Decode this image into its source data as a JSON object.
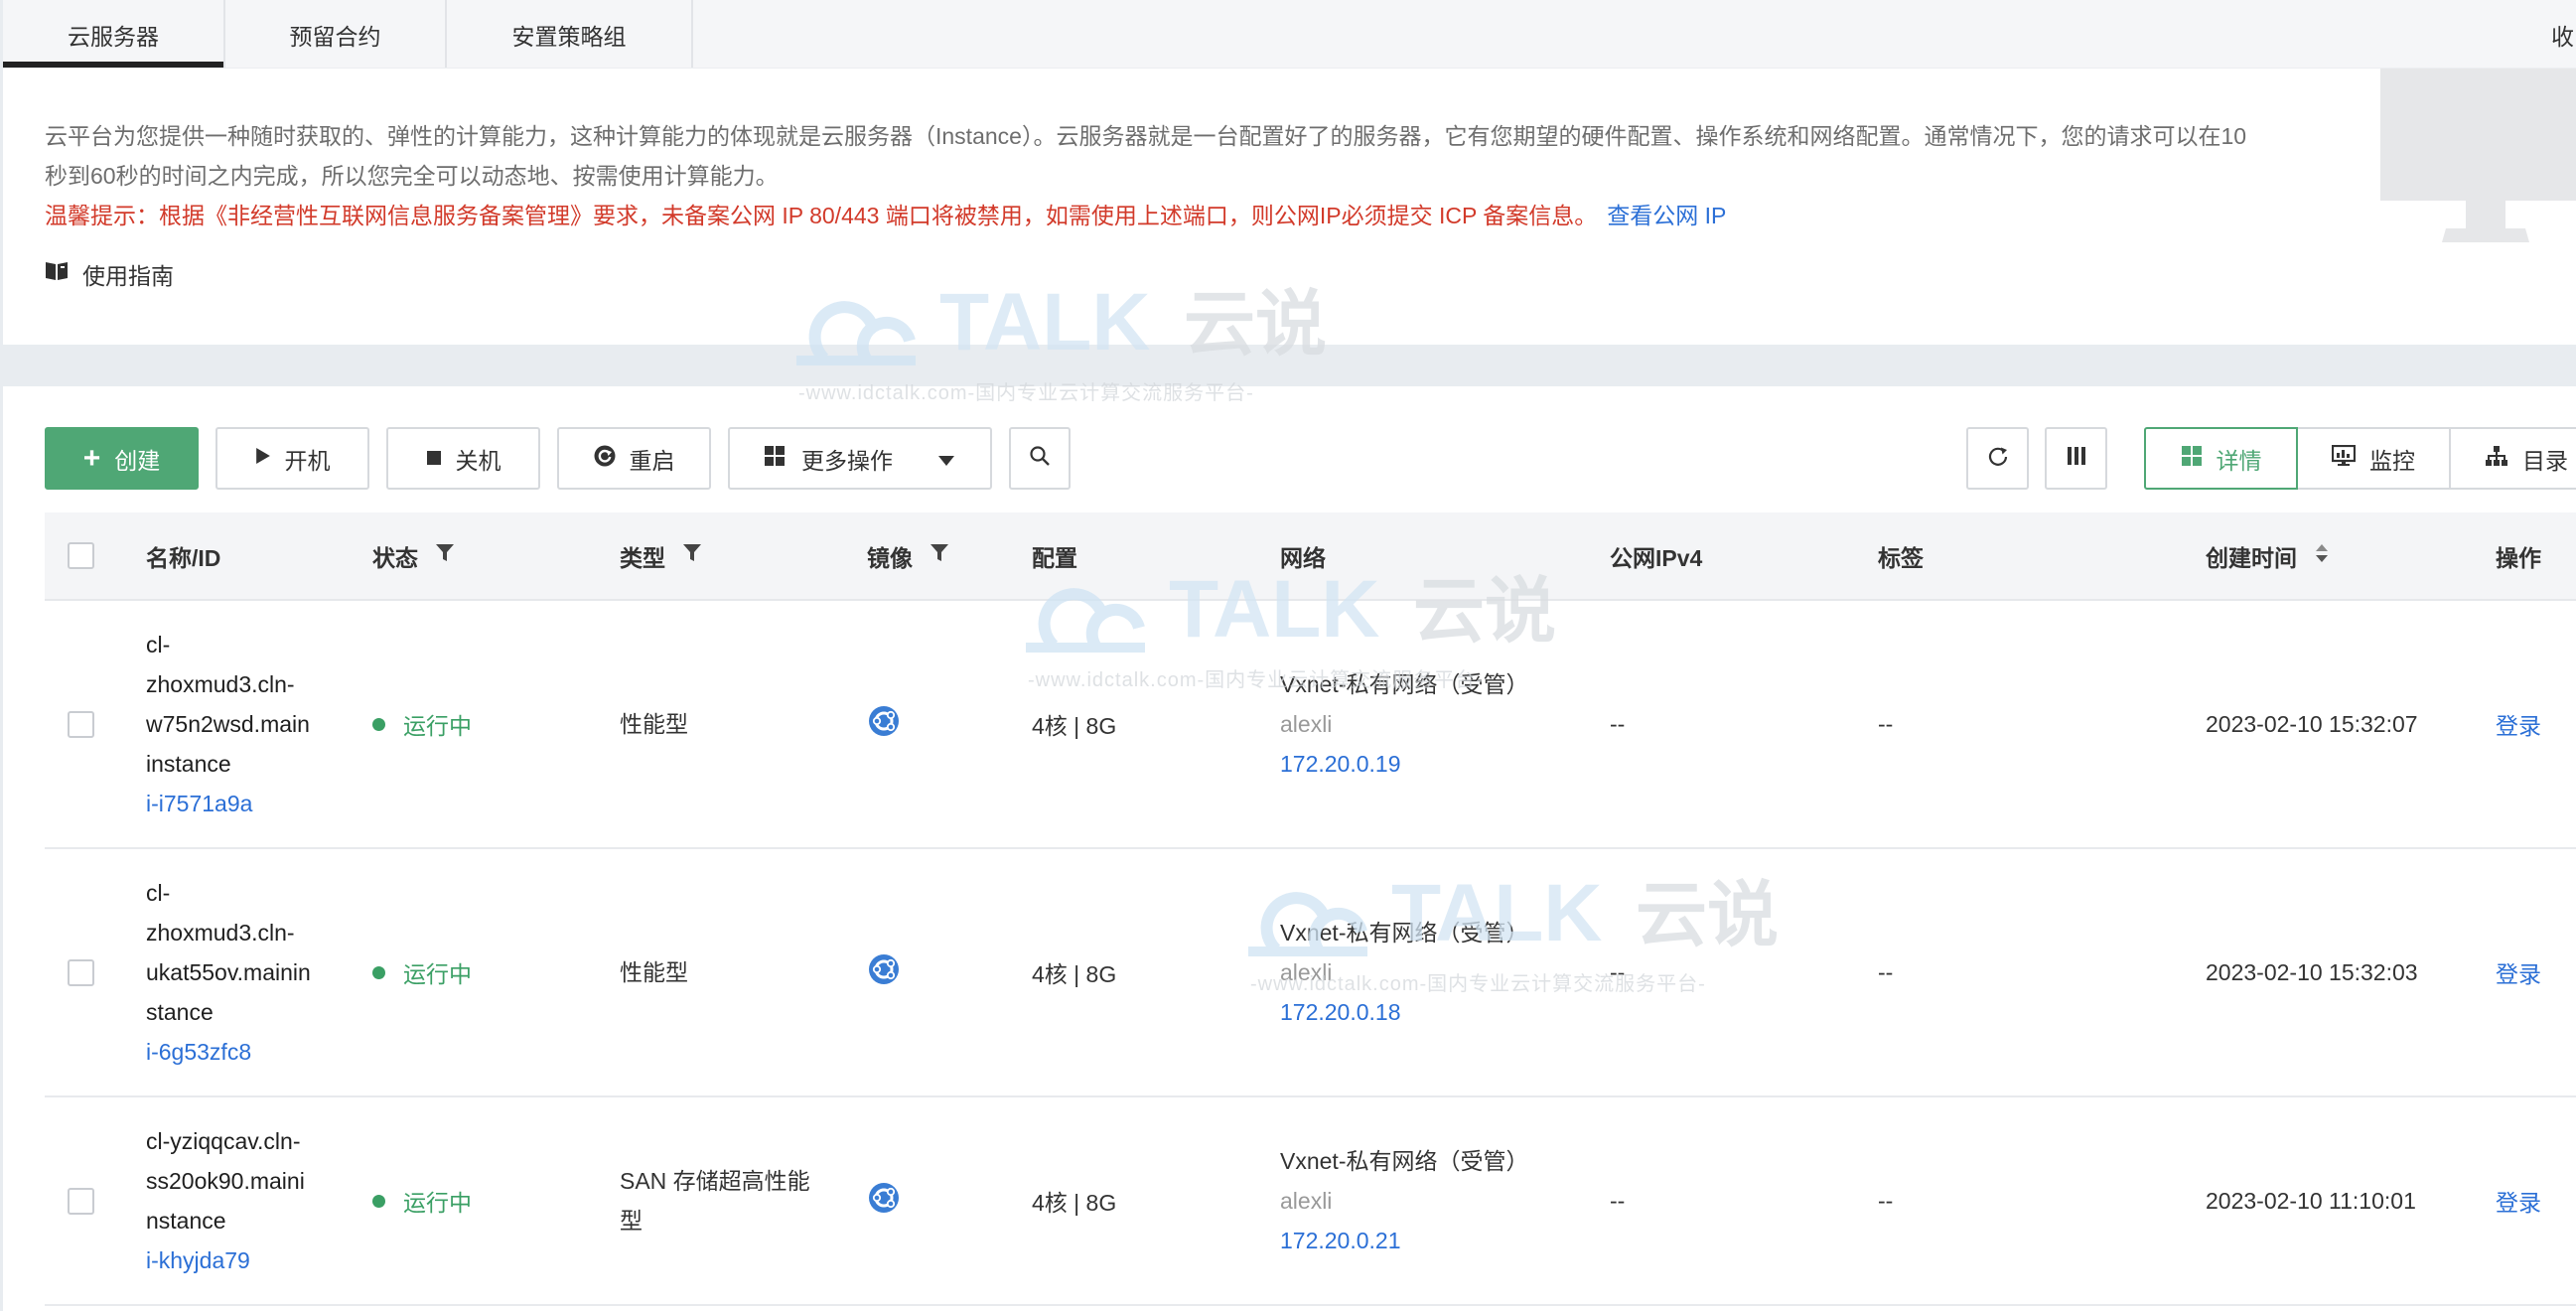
{
  "colors": {
    "accent": "#4fa775",
    "link": "#2b6fd6",
    "warning": "#d23a2a",
    "status_running": "#3a9f64",
    "muted": "#999999"
  },
  "tabs": [
    {
      "label": "云服务器",
      "active": true
    },
    {
      "label": "预留合约",
      "active": false
    },
    {
      "label": "安置策略组",
      "active": false
    }
  ],
  "tabbar_right_label": "收",
  "intro": {
    "description": "云平台为您提供一种随时获取的、弹性的计算能力，这种计算能力的体现就是云服务器（Instance）。云服务器就是一台配置好了的服务器，它有您期望的硬件配置、操作系统和网络配置。通常情况下，您的请求可以在10秒到60秒的时间之内完成，所以您完全可以动态地、按需使用计算能力。",
    "warning": "温馨提示：根据《非经营性互联网信息服务备案管理》要求，未备案公网 IP 80/443 端口将被禁用，如需使用上述端口，则公网IP必须提交 ICP 备案信息。",
    "warning_link": "查看公网 IP",
    "guide_label": "使用指南",
    "guide_icon": "book-icon",
    "illustration_icon": "monitor-illustration"
  },
  "toolbar": {
    "create": "创建",
    "start": "开机",
    "stop": "关机",
    "restart": "重启",
    "more": "更多操作",
    "view_detail": "详情",
    "view_monitor": "监控",
    "view_directory": "目录",
    "active_view": "详情",
    "icons": [
      "plus-icon",
      "play-icon",
      "stop-icon",
      "restart-icon",
      "grid-icon",
      "caret-down-icon",
      "search-icon",
      "refresh-icon",
      "columns-icon",
      "grid-view-icon",
      "monitor-icon",
      "sitemap-icon"
    ]
  },
  "table": {
    "columns": [
      {
        "label": "名称/ID"
      },
      {
        "label": "状态",
        "filterable": true
      },
      {
        "label": "类型",
        "filterable": true
      },
      {
        "label": "镜像",
        "filterable": true
      },
      {
        "label": "配置"
      },
      {
        "label": "网络"
      },
      {
        "label": "公网IPv4"
      },
      {
        "label": "标签"
      },
      {
        "label": "创建时间",
        "sortable": true
      },
      {
        "label": "操作"
      }
    ],
    "rows": [
      {
        "name_lines": [
          "cl-",
          "zhoxmud3.cln-",
          "w75n2wsd.main",
          "instance"
        ],
        "id": "i-i7571a9a",
        "status": "运行中",
        "type_lines": [
          "性能型"
        ],
        "image_icon": "os-image-icon",
        "config": "4核 | 8G",
        "network": {
          "name": "Vxnet-私有网络（受管）",
          "owner": "alexli",
          "ip": "172.20.0.19"
        },
        "public_ipv4": "--",
        "tags": "--",
        "created": "2023-02-10 15:32:07",
        "action": "登录"
      },
      {
        "name_lines": [
          "cl-",
          "zhoxmud3.cln-",
          "ukat55ov.mainin",
          "stance"
        ],
        "id": "i-6g53zfc8",
        "status": "运行中",
        "type_lines": [
          "性能型"
        ],
        "image_icon": "os-image-icon",
        "config": "4核 | 8G",
        "network": {
          "name": "Vxnet-私有网络（受管）",
          "owner": "alexli",
          "ip": "172.20.0.18"
        },
        "public_ipv4": "--",
        "tags": "--",
        "created": "2023-02-10 15:32:03",
        "action": "登录"
      },
      {
        "name_lines": [
          "cl-yziqqcav.cln-",
          "ss20ok90.maini",
          "nstance"
        ],
        "id": "i-khyjda79",
        "status": "运行中",
        "type_lines": [
          "SAN 存储超高性能",
          "型"
        ],
        "image_icon": "os-image-icon",
        "config": "4核 | 8G",
        "network": {
          "name": "Vxnet-私有网络（受管）",
          "owner": "alexli",
          "ip": "172.20.0.21"
        },
        "public_ipv4": "--",
        "tags": "--",
        "created": "2023-02-10 11:10:01",
        "action": "登录"
      }
    ]
  },
  "watermark": {
    "brand": "TALK",
    "brand_cn": "云说",
    "slogan": "-www.idctalk.com-国内专业云计算交流服务平台-"
  }
}
